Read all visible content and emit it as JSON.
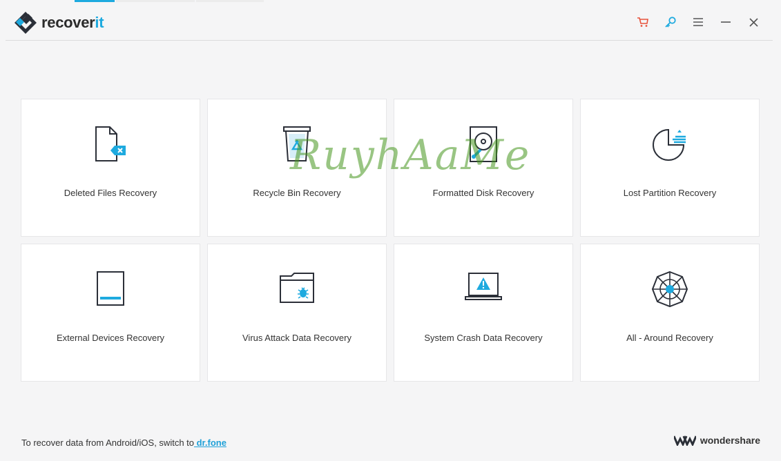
{
  "app": {
    "brand_main": "recover",
    "brand_accent": "it",
    "accent_color": "#1eaadf",
    "cart_color": "#e8533c"
  },
  "window_controls": [
    {
      "name": "cart-icon"
    },
    {
      "name": "key-icon"
    },
    {
      "name": "menu-icon"
    },
    {
      "name": "minimize-icon"
    },
    {
      "name": "close-icon"
    }
  ],
  "cards": [
    {
      "label": "Deleted Files Recovery",
      "icon": "deleted-file-icon"
    },
    {
      "label": "Recycle Bin Recovery",
      "icon": "recycle-bin-icon"
    },
    {
      "label": "Formatted Disk Recovery",
      "icon": "formatted-disk-icon"
    },
    {
      "label": "Lost Partition Recovery",
      "icon": "lost-partition-icon"
    },
    {
      "label": "External Devices Recovery",
      "icon": "external-device-icon"
    },
    {
      "label": "Virus Attack Data Recovery",
      "icon": "virus-folder-icon"
    },
    {
      "label": "System Crash Data Recovery",
      "icon": "system-crash-icon"
    },
    {
      "label": "All - Around Recovery",
      "icon": "all-around-icon"
    }
  ],
  "footer": {
    "prompt": "To recover data from Android/iOS, switch to",
    "link": " dr.fone",
    "company": "wondershare"
  },
  "watermark": "RuyhAaMe"
}
